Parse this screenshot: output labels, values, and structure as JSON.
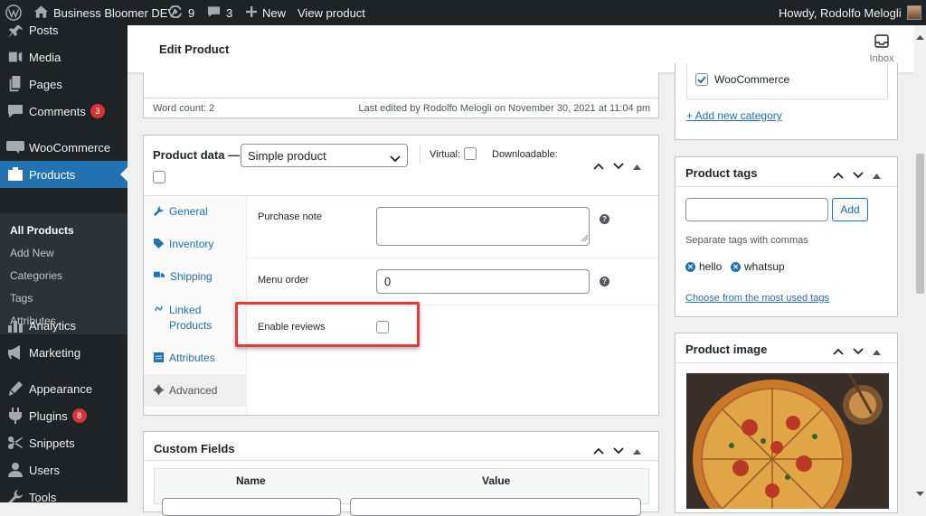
{
  "admin_bar": {
    "site_name": "Business Bloomer DEV",
    "updates_count": "9",
    "comments_count": "3",
    "new_label": "New",
    "view_product_label": "View product",
    "howdy": "Howdy, Rodolfo Melogli"
  },
  "sidebar": {
    "items": [
      {
        "label": "Posts",
        "icon": "pin-icon"
      },
      {
        "label": "Media",
        "icon": "media-icon"
      },
      {
        "label": "Pages",
        "icon": "pages-icon"
      },
      {
        "label": "Comments",
        "icon": "comments-icon",
        "badge": "3"
      },
      {
        "label": "WooCommerce",
        "icon": "woocommerce-icon"
      },
      {
        "label": "Products",
        "icon": "products-icon"
      },
      {
        "label": "Analytics",
        "icon": "analytics-icon"
      },
      {
        "label": "Marketing",
        "icon": "marketing-icon"
      },
      {
        "label": "Appearance",
        "icon": "appearance-icon"
      },
      {
        "label": "Plugins",
        "icon": "plugins-icon",
        "badge": "8"
      },
      {
        "label": "Snippets",
        "icon": "snippets-icon"
      },
      {
        "label": "Users",
        "icon": "users-icon"
      },
      {
        "label": "Tools",
        "icon": "tools-icon"
      }
    ],
    "submenu": [
      "All Products",
      "Add New",
      "Categories",
      "Tags",
      "Attributes"
    ]
  },
  "header": {
    "title": "Edit Product",
    "inbox_label": "Inbox"
  },
  "editor": {
    "word_count": "Word count: 2",
    "last_edited": "Last edited by Rodolfo Melogli on November 30, 2021 at 11:04 pm"
  },
  "product_data": {
    "title": "Product data —",
    "product_type": "Simple product",
    "virtual_label": "Virtual:",
    "downloadable_label": "Downloadable:",
    "tabs": [
      {
        "label": "General",
        "icon": "wrench-icon"
      },
      {
        "label": "Inventory",
        "icon": "tag-icon"
      },
      {
        "label": "Shipping",
        "icon": "truck-icon"
      },
      {
        "label": "Linked Products",
        "icon": "link-icon"
      },
      {
        "label": "Attributes",
        "icon": "table-icon"
      },
      {
        "label": "Advanced",
        "icon": "gear-icon"
      }
    ],
    "purchase_note_label": "Purchase note",
    "purchase_note_value": "",
    "menu_order_label": "Menu order",
    "menu_order_value": "0",
    "enable_reviews_label": "Enable reviews",
    "highlight_color": "#e53935"
  },
  "custom_fields": {
    "title": "Custom Fields",
    "columns": [
      "Name",
      "Value"
    ]
  },
  "categories": {
    "woocommerce_label": "WooCommerce",
    "add_new_category": "+ Add new category"
  },
  "product_tags": {
    "title": "Product tags",
    "add_button": "Add",
    "hint": "Separate tags with commas",
    "tags": [
      "hello",
      "whatsup"
    ],
    "most_used_link": "Choose from the most used tags"
  },
  "product_image": {
    "title": "Product image"
  },
  "colors": {
    "accent": "#2271b1",
    "admin_bar": "#1d2327",
    "badge": "#d63638"
  }
}
